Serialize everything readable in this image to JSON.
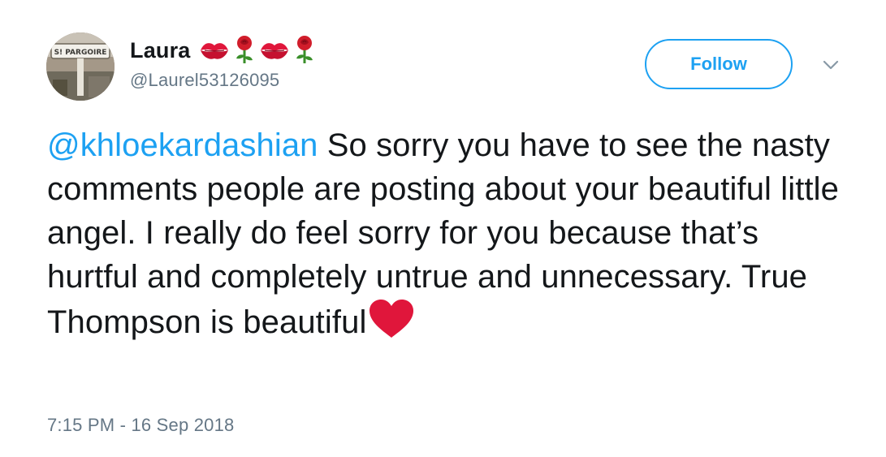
{
  "user": {
    "display_name": "Laura",
    "name_emojis": [
      "kiss-mark-icon",
      "rose-icon",
      "kiss-mark-icon",
      "rose-icon"
    ],
    "handle": "@Laurel53126095",
    "avatar_sign_text": "S! PARGOIRE"
  },
  "actions": {
    "follow_label": "Follow",
    "menu_icon": "chevron-down-icon"
  },
  "tweet": {
    "mention": "@khloekardashian",
    "body": " So sorry you have to see the nasty comments people are posting about your beautiful little angel. I really do feel sorry for you because that’s hurtful and completely untrue and unnecessary. True Thompson is beautiful",
    "trailing_emoji": "red-heart-icon",
    "timestamp": "7:15 PM - 16 Sep 2018"
  },
  "colors": {
    "accent": "#1da1f2",
    "text": "#14171a",
    "muted": "#657786",
    "heart": "#e0163b",
    "kiss": "#e0163b",
    "rose": "#d11d2b",
    "stem": "#3a8f2a"
  }
}
